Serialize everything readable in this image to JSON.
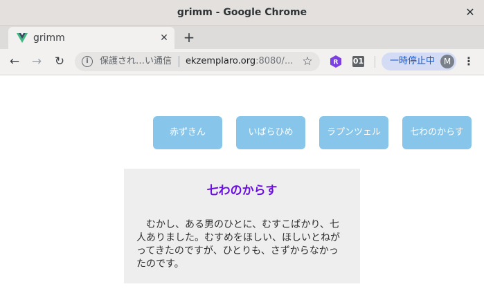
{
  "window": {
    "title": "grimm - Google Chrome",
    "close_glyph": "✕"
  },
  "tab": {
    "title": "grimm",
    "close_glyph": "✕",
    "new_tab_glyph": "+"
  },
  "toolbar": {
    "back_glyph": "←",
    "forward_glyph": "→",
    "reload_glyph": "↻",
    "info_glyph": "i",
    "security_label": "保護され…い通信",
    "url_host": "ekzemplaro.org",
    "url_rest": ":8080/...",
    "star_glyph": "☆",
    "extension_r_label": "R",
    "extension_01_label": "01",
    "paused_label": "一時停止中",
    "avatar_initial": "M",
    "menu_glyph": "⋮"
  },
  "stories": {
    "buttons": [
      "赤ずきん",
      "いばらひめ",
      "ラプンツェル",
      "七わのからす"
    ],
    "selected": {
      "title": "七わのからす",
      "body": "むかし、ある男のひとに、むすこばかり、七人ありました。むすめをほしい、ほしいとねがってきたのですが、ひとりも、さずからなかったのです。"
    }
  },
  "colors": {
    "button_bg": "#87c6ea",
    "title_color": "#6a0fe0",
    "panel_bg": "#eeeeee",
    "paused_pill_bg": "#d3dcf4",
    "paused_text": "#1a56c4"
  }
}
